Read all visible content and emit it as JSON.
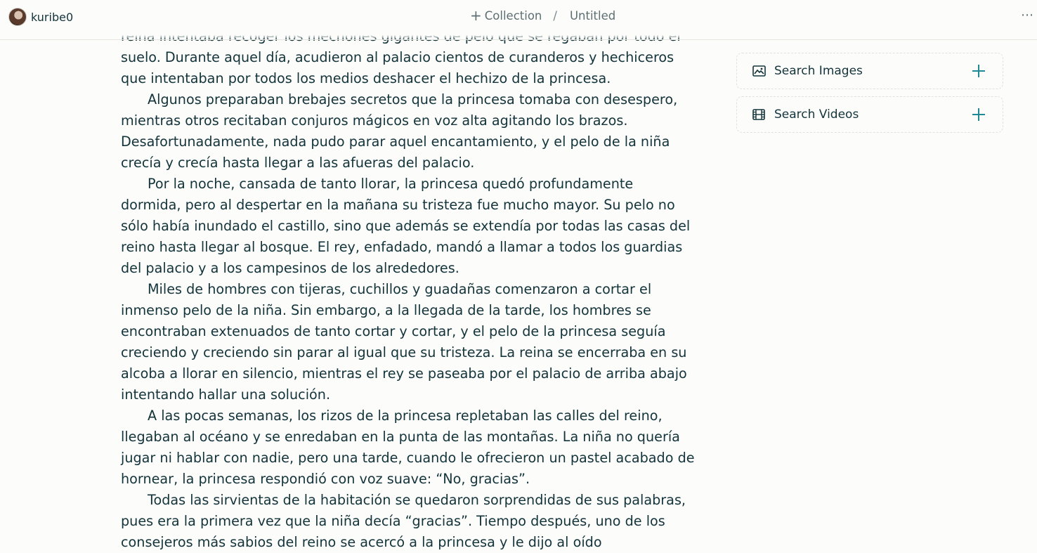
{
  "header": {
    "username": "kuribe0",
    "breadcrumb": {
      "collection_label": "Collection",
      "separator": "/",
      "title": "Untitled"
    },
    "more_label": "⋯"
  },
  "document": {
    "cut_line": "reina intentaba recoger los mechones gigantes de pelo que se regaban por todo el",
    "paragraphs": [
      "suelo. Durante aquel día, acudieron al palacio cientos de curanderos y hechiceros que intentaban por todos los medios deshacer el hechizo de la princesa.",
      "Algunos preparaban brebajes secretos que la princesa tomaba con desespero, mientras otros recitaban conjuros mágicos en voz alta agitando los brazos. Desafortunadamente, nada pudo parar aquel encantamiento, y el pelo de la niña crecía y crecía hasta llegar a las afueras del palacio.",
      "Por la noche, cansada de tanto llorar, la princesa quedó profundamente dormida, pero al despertar en la mañana su tristeza fue mucho mayor. Su pelo no sólo había inundado el castillo, sino que además se extendía por todas las casas del reino hasta llegar al bosque. El rey, enfadado, mandó a llamar a todos los guardias del palacio y a los campesinos de los alrededores.",
      "Miles de hombres con tijeras, cuchillos y guadañas comenzaron a cortar el inmenso pelo de la niña. Sin embargo, a la llegada de la tarde, los hombres se encontraban extenuados de tanto cortar y cortar, y el pelo de la princesa seguía creciendo y creciendo sin parar al igual que su tristeza. La reina se encerraba en su alcoba a llorar en silencio, mientras el rey se paseaba por el palacio de arriba abajo intentando hallar una solución.",
      "A las pocas semanas, los rizos de la princesa repletaban las calles del reino, llegaban al océano y se enredaban en la punta de las montañas. La niña no quería jugar ni hablar con nadie, pero una tarde, cuando le ofrecieron un pastel acabado de hornear, la princesa respondió con voz suave: “No, gracias”.",
      "Todas las sirvientas de la habitación se quedaron sorprendidas de sus palabras, pues era la primera vez que la niña decía “gracias”. Tiempo después, uno de los consejeros más sabios del reino se acercó a la princesa y le dijo al oído"
    ]
  },
  "sidebar": {
    "panels": [
      {
        "label": "Search Images",
        "icon": "image-icon"
      },
      {
        "label": "Search Videos",
        "icon": "film-icon"
      }
    ]
  },
  "colors": {
    "accent": "#1f8a95",
    "text": "#13343b",
    "background": "#fcfcfa"
  }
}
